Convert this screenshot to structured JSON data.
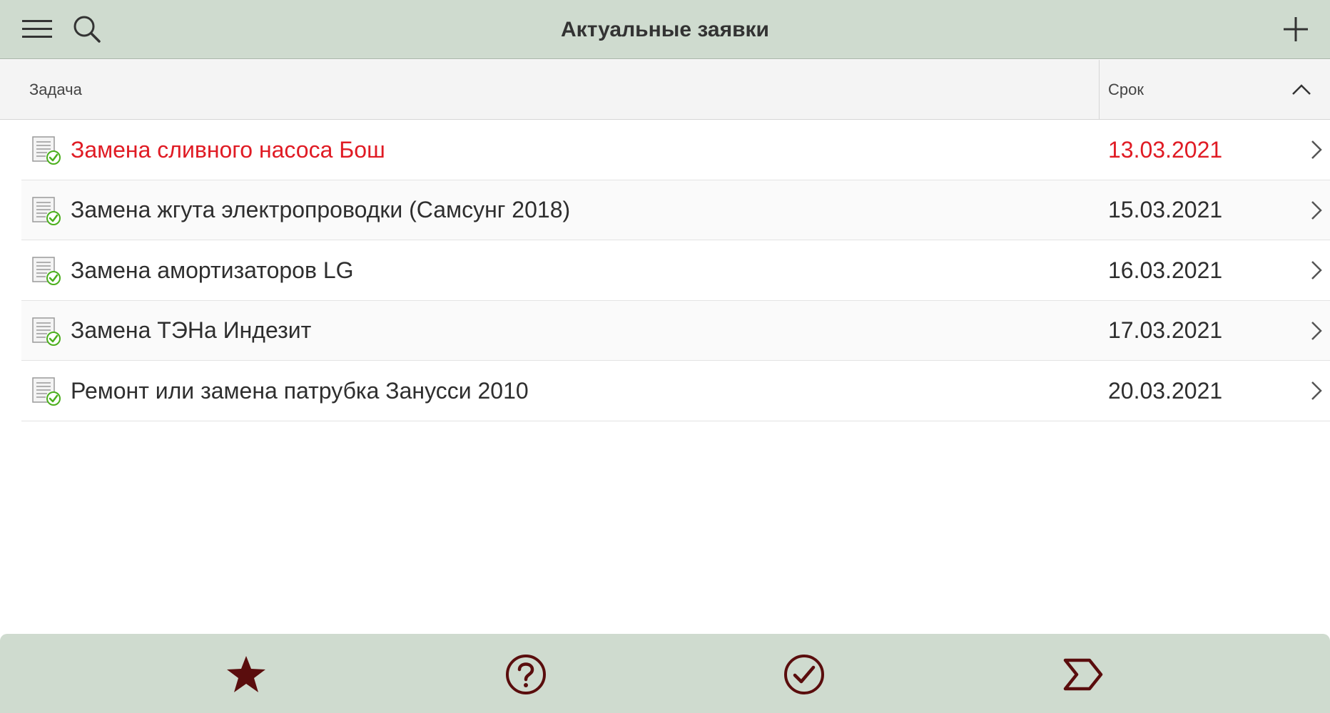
{
  "header": {
    "title": "Актуальные заявки",
    "menu_icon": "hamburger-menu-icon",
    "search_icon": "search-icon",
    "add_icon": "plus-icon"
  },
  "columns": {
    "task": "Задача",
    "deadline": "Срок",
    "sort_icon": "chevron-up-icon"
  },
  "tasks": [
    {
      "title": "Замена сливного насоса Бош",
      "date": "13.03.2021",
      "overdue": true
    },
    {
      "title": "Замена жгута электропроводки (Самсунг 2018)",
      "date": "15.03.2021",
      "overdue": false
    },
    {
      "title": "Замена амортизаторов LG",
      "date": "16.03.2021",
      "overdue": false
    },
    {
      "title": "Замена ТЭНа Индезит",
      "date": "17.03.2021",
      "overdue": false
    },
    {
      "title": "Ремонт или замена патрубка Занусси 2010",
      "date": "20.03.2021",
      "overdue": false
    }
  ],
  "colors": {
    "bar_background": "#cfdbcf",
    "overdue_text": "#e01b24",
    "tab_icon": "#5a0d0d",
    "check_green": "#4caf1e"
  },
  "bottom_tabs": [
    {
      "icon": "star-icon"
    },
    {
      "icon": "question-circle-icon"
    },
    {
      "icon": "check-circle-icon"
    },
    {
      "icon": "forward-chevron-icon"
    }
  ]
}
